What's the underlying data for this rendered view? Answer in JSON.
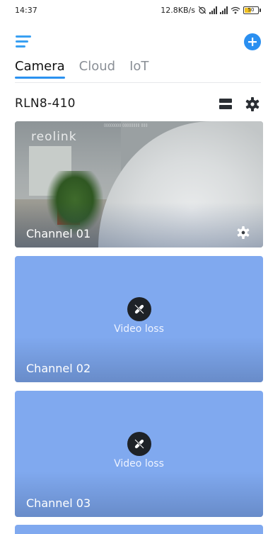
{
  "status_bar": {
    "time": "14:37",
    "net_speed": "12.8KB/s",
    "battery": "50"
  },
  "header": {
    "menu_icon": "hamburger-menu-icon",
    "add_icon": "plus-circle-icon"
  },
  "tabs": [
    {
      "label": "Camera",
      "active": true
    },
    {
      "label": "Cloud",
      "active": false
    },
    {
      "label": "IoT",
      "active": false
    }
  ],
  "device": {
    "name": "RLN8-410"
  },
  "channels": [
    {
      "label": "Channel 01",
      "state": "live",
      "brand": "reolink"
    },
    {
      "label": "Channel 02",
      "state": "loss",
      "message": "Video loss"
    },
    {
      "label": "Channel 03",
      "state": "loss",
      "message": "Video loss"
    }
  ],
  "colors": {
    "accent": "#2a8ff0",
    "card_loss": "#80a9ef",
    "tab_underline": "#2b92f0"
  }
}
